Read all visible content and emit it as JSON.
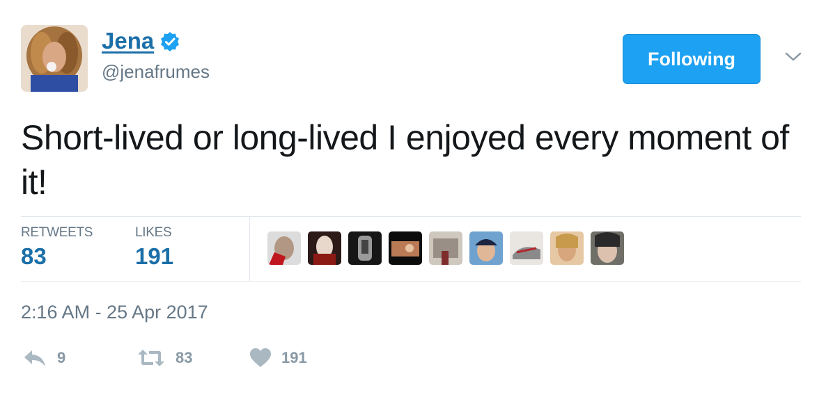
{
  "user": {
    "display_name": "Jena",
    "handle": "@jenafrumes",
    "verified": true
  },
  "follow_button": {
    "label": "Following"
  },
  "tweet": {
    "text": "Short-lived or long-lived I enjoyed every moment of it!"
  },
  "stats": {
    "retweets": {
      "label": "RETWEETS",
      "count": "83"
    },
    "likes": {
      "label": "LIKES",
      "count": "191"
    }
  },
  "likers_count_shown": 9,
  "timestamp": "2:16 AM - 25 Apr 2017",
  "actions": {
    "reply": {
      "icon": "reply-icon",
      "count": "9"
    },
    "retweet": {
      "icon": "retweet-icon",
      "count": "83"
    },
    "like": {
      "icon": "heart-icon",
      "count": "191"
    }
  },
  "colors": {
    "accent": "#1da1f2",
    "link": "#1b6fa8",
    "muted": "#657786",
    "action_gray": "#8899a6",
    "divider": "#e1e8ed"
  }
}
